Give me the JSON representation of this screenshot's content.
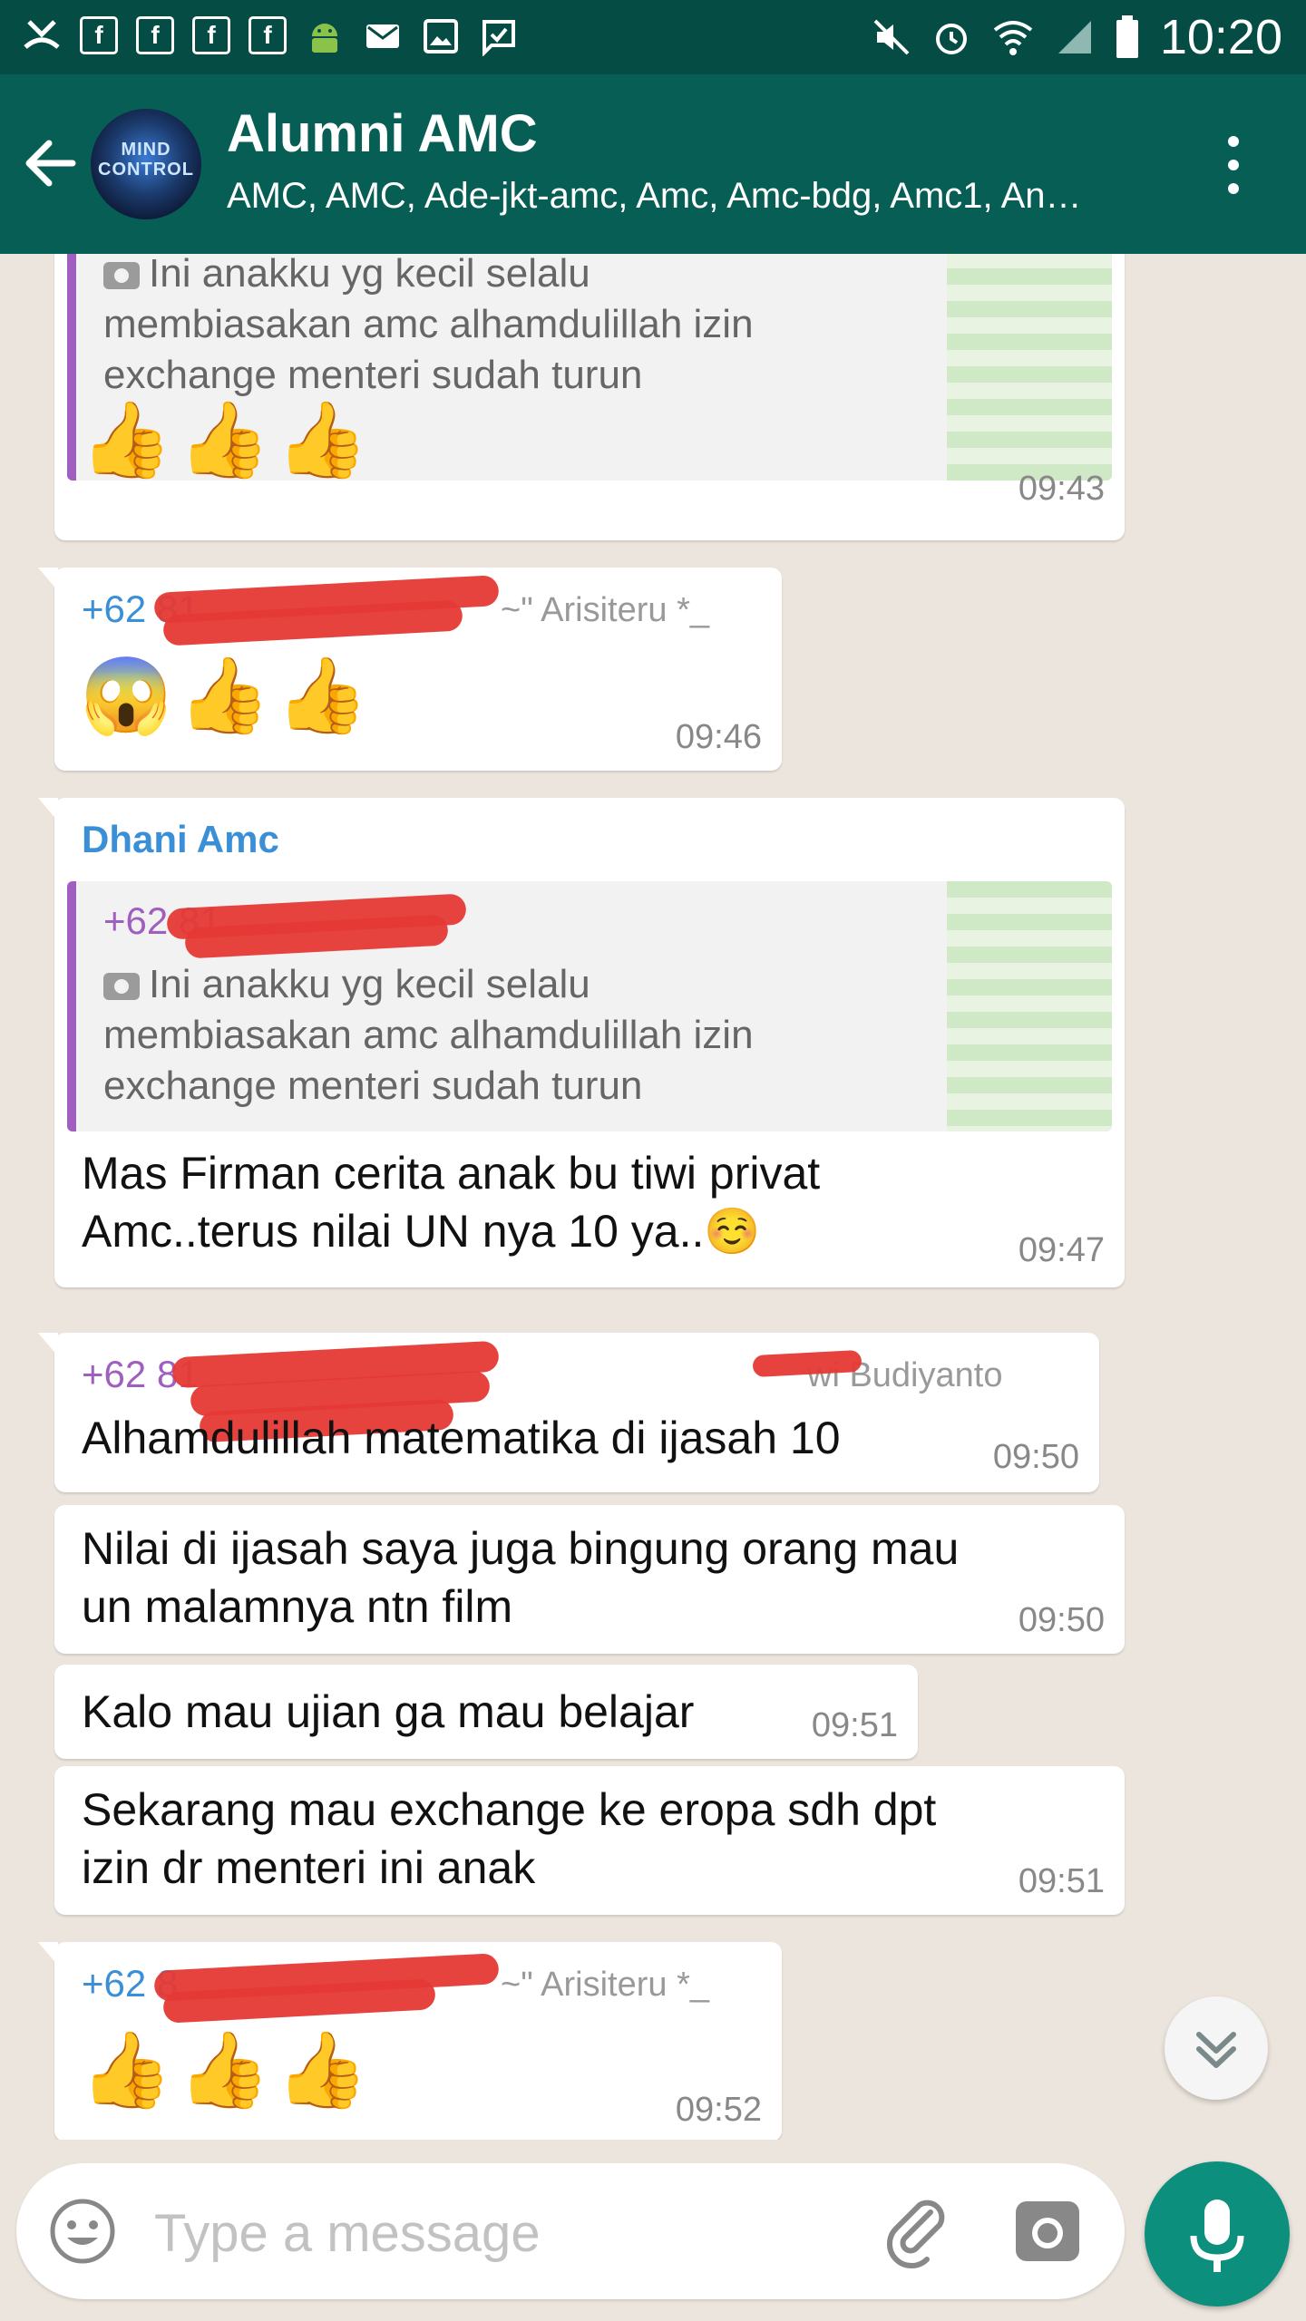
{
  "status_bar": {
    "time": "10:20",
    "left_icons": [
      "missed-call-icon",
      "facebook-icon",
      "facebook-icon",
      "facebook-icon",
      "facebook-icon",
      "android-update-icon",
      "email-icon",
      "image-icon",
      "sms-icon"
    ],
    "right_icons": [
      "mute-icon",
      "alarm-icon",
      "wifi-icon",
      "signal-icon",
      "battery-icon"
    ]
  },
  "header": {
    "title": "Alumni AMC",
    "members": "AMC, AMC, Ade-jkt-amc, Amc, Amc-bdg, Amc1, An…",
    "avatar_text_1": "MIND",
    "avatar_text_2": "CONTROL"
  },
  "messages": [
    {
      "quote_text_1": "Ini anakku yg kecil selalu",
      "quote_text_2": "membiasakan amc alhamdulillah izin",
      "quote_text_3": "exchange menteri sudah turun",
      "emoji": "👍👍👍",
      "time": "09:43"
    },
    {
      "sender": "+62 81",
      "sender_alias": "~\" Arisiteru *_",
      "emoji": "😱👍👍",
      "time": "09:46"
    },
    {
      "sender": "Dhani Amc",
      "quote_sender": "+62 81",
      "quote_text_1": "Ini anakku yg kecil selalu",
      "quote_text_2": "membiasakan amc alhamdulillah izin",
      "quote_text_3": "exchange menteri sudah turun",
      "text_1": "Mas Firman cerita anak bu tiwi privat",
      "text_2": "Amc..terus nilai UN nya 10 ya..☺️",
      "time": "09:47"
    },
    {
      "sender": "+62 81",
      "sender_alias": "wi Budiyanto",
      "text_1": "Alhamdulillah matematika di ijasah 10",
      "time": "09:50"
    },
    {
      "text_1": "Nilai di ijasah saya juga bingung orang mau",
      "text_2": "un malamnya ntn film",
      "time": "09:50"
    },
    {
      "text_1": "Kalo mau ujian ga mau belajar",
      "time": "09:51"
    },
    {
      "text_1": "Sekarang mau exchange ke eropa sdh dpt",
      "text_2": "izin dr menteri ini anak",
      "time": "09:51"
    },
    {
      "sender": "+62 8",
      "sender_alias": "~\" Arisiteru *_",
      "emoji": "👍👍👍",
      "time": "09:52"
    }
  ],
  "input": {
    "placeholder": "Type a message"
  },
  "colors": {
    "status_bar": "#054d44",
    "app_bar": "#075e54",
    "chat_bg": "#ece5dd",
    "mic_button": "#0c8f7d",
    "sender_blue": "#3a8fd6",
    "sender_purple": "#a05fbf",
    "redaction": "#e53935"
  }
}
